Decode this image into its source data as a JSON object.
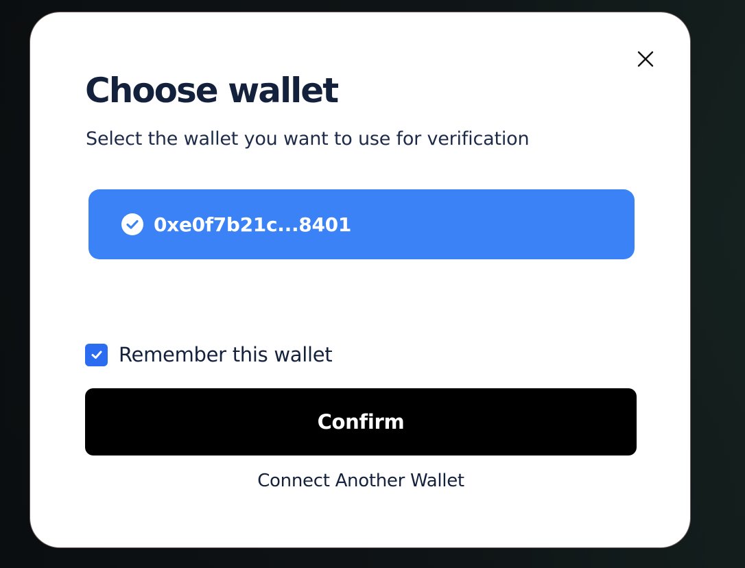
{
  "modal": {
    "title": "Choose wallet",
    "subtitle": "Select the wallet you want to use for verification",
    "close_icon": "close-icon"
  },
  "wallets": [
    {
      "address": "0xe0f7b21c...8401",
      "selected": true,
      "icon": "check-circle-icon"
    }
  ],
  "remember": {
    "label": "Remember this wallet",
    "checked": true
  },
  "actions": {
    "confirm_label": "Confirm",
    "connect_another_label": "Connect Another Wallet"
  },
  "colors": {
    "accent": "#3b82f6",
    "checkbox": "#2b6cf0",
    "text_primary": "#14213d",
    "button_bg": "#000000"
  }
}
